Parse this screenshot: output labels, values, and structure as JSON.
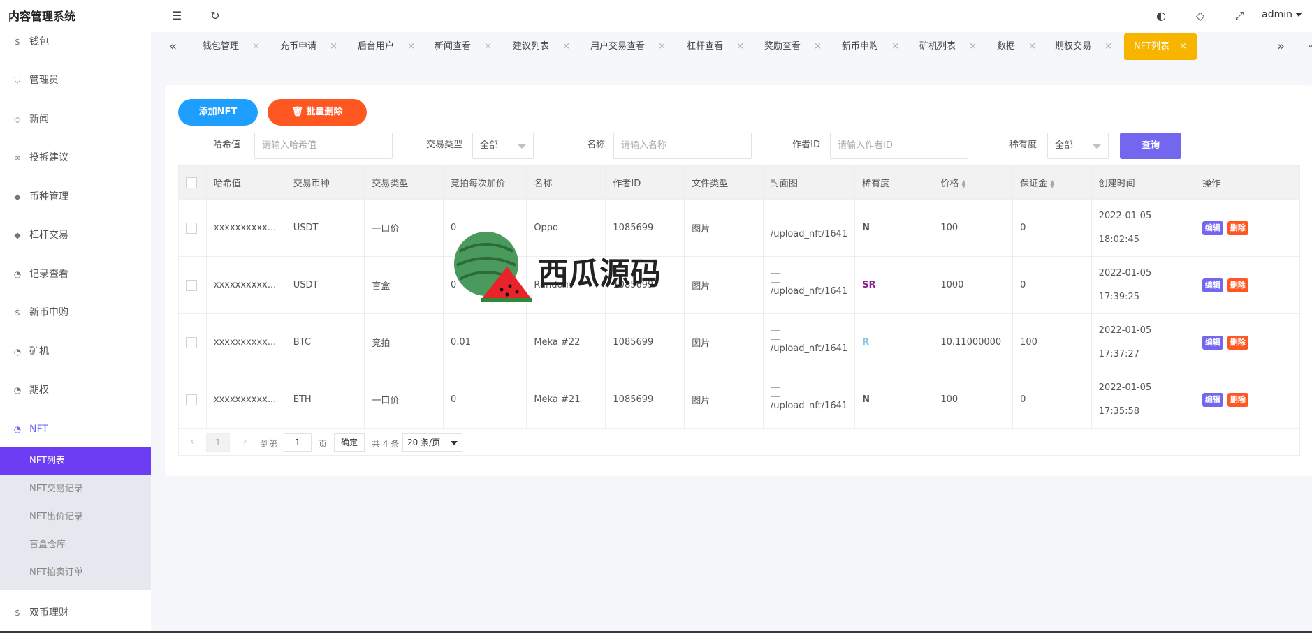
{
  "app": {
    "title": "内容管理系统",
    "user": "admin"
  },
  "sidebar": {
    "items": [
      {
        "label": "钱包",
        "icon": "dollar-circle-icon"
      },
      {
        "label": "管理员",
        "icon": "shield-icon"
      },
      {
        "label": "新闻",
        "icon": "tag-icon"
      },
      {
        "label": "投拆建议",
        "icon": "link-icon"
      },
      {
        "label": "币种管理",
        "icon": "diamond-icon"
      },
      {
        "label": "杠杆交易",
        "icon": "diamond-icon"
      },
      {
        "label": "记录查看",
        "icon": "circle-icon"
      },
      {
        "label": "新币申购",
        "icon": "dollar-circle-icon"
      },
      {
        "label": "矿机",
        "icon": "circle-icon"
      },
      {
        "label": "期权",
        "icon": "circle-icon"
      },
      {
        "label": "NFT",
        "icon": "circle-icon"
      },
      {
        "label": "双币理财",
        "icon": "dollar-circle-icon"
      }
    ],
    "nft_sub": [
      "NFT列表",
      "NFT交易记录",
      "NFT出价记录",
      "盲盒仓库",
      "NFT拍卖订单"
    ]
  },
  "tabs": [
    "钱包管理",
    "充币申请",
    "后台用户",
    "新闻查看",
    "建议列表",
    "用户交易查看",
    "杠杆查看",
    "奖励查看",
    "新币申购",
    "矿机列表",
    "数据",
    "期权交易",
    "NFT列表"
  ],
  "toolbar": {
    "add": "添加NFT",
    "batch_delete": "批量删除"
  },
  "filters": {
    "hash_label": "哈希值",
    "hash_placeholder": "请输入哈希值",
    "type_label": "交易类型",
    "type_value": "全部",
    "name_label": "名称",
    "name_placeholder": "请输入名称",
    "author_label": "作者ID",
    "author_placeholder": "请输入作者ID",
    "rarity_label": "稀有度",
    "rarity_value": "全部",
    "query": "查询"
  },
  "table": {
    "headers": [
      "哈希值",
      "交易币种",
      "交易类型",
      "竞拍每次加价",
      "名称",
      "作者ID",
      "文件类型",
      "封面图",
      "稀有度",
      "价格",
      "保证金",
      "创建时间",
      "操作"
    ],
    "rows": [
      {
        "hash": "xxxxxxxxxx...",
        "coin": "USDT",
        "type": "一口价",
        "inc": "0",
        "name": "Oppo",
        "author": "1085699",
        "file": "图片",
        "cover": "/upload_nft/1641",
        "rarity": "N",
        "price": "100",
        "deposit": "0",
        "date": "2022-01-05",
        "time": "18:02:45"
      },
      {
        "hash": "xxxxxxxxxx...",
        "coin": "USDT",
        "type": "盲盒",
        "inc": "0",
        "name": "Random",
        "author": "1085699",
        "file": "图片",
        "cover": "/upload_nft/1641",
        "rarity": "SR",
        "price": "1000",
        "deposit": "0",
        "date": "2022-01-05",
        "time": "17:39:25"
      },
      {
        "hash": "xxxxxxxxxx...",
        "coin": "BTC",
        "type": "竞拍",
        "inc": "0.01",
        "name": "Meka #22",
        "author": "1085699",
        "file": "图片",
        "cover": "/upload_nft/1641",
        "rarity": "R",
        "price": "10.11000000",
        "deposit": "100",
        "date": "2022-01-05",
        "time": "17:37:27"
      },
      {
        "hash": "xxxxxxxxxx...",
        "coin": "ETH",
        "type": "一口价",
        "inc": "0",
        "name": "Meka #21",
        "author": "1085699",
        "file": "图片",
        "cover": "/upload_nft/1641",
        "rarity": "N",
        "price": "100",
        "deposit": "0",
        "date": "2022-01-05",
        "time": "17:35:58"
      }
    ],
    "edit": "编辑",
    "delete": "删除",
    "rarity_colors": {
      "N": "#555555",
      "SR": "#8b1f8f",
      "R": "#7ec8e3"
    }
  },
  "pager": {
    "current": "1",
    "goto": "到第",
    "page_input": "1",
    "page_unit": "页",
    "confirm": "确定",
    "total": "共 4 条",
    "size": "20 条/页"
  },
  "watermark": "西瓜源码",
  "colors": {
    "accent": "#6c63ff",
    "tab_active": "#f7b500",
    "add": "#1e9fff",
    "danger": "#ff5722",
    "query": "#7367f0"
  }
}
